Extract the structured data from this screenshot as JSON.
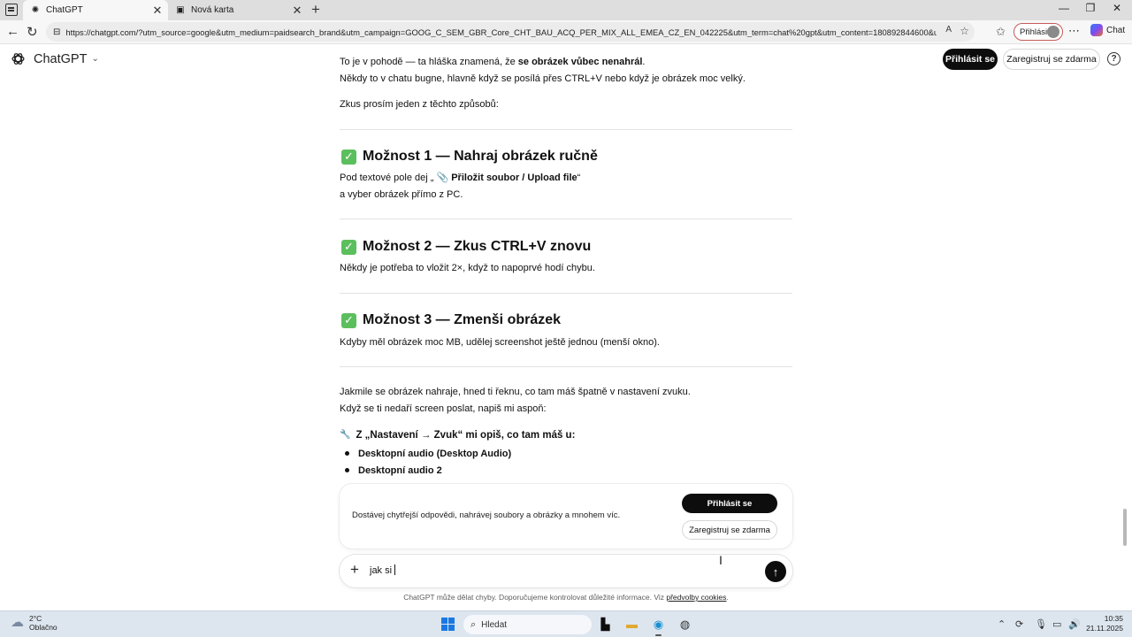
{
  "browser": {
    "tabs": [
      {
        "title": "ChatGPT",
        "active": true
      },
      {
        "title": "Nová karta",
        "active": false
      }
    ],
    "url": "https://chatgpt.com/?utm_source=google&utm_medium=paidsearch_brand&utm_campaign=GOOG_C_SEM_GBR_Core_CHT_BAU_ACQ_PER_MIX_ALL_EMEA_CZ_EN_042225&utm_term=chat%20gpt&utm_content=180892844600&utm_ad=7...",
    "profile_label": "Přihlásit",
    "copilot_label": "Chat"
  },
  "header": {
    "brand": "ChatGPT",
    "login_label": "Přihlásit se",
    "register_label": "Zaregistruj se zdarma"
  },
  "message": {
    "intro_1_prefix": "To je v pohodě — ta hláška znamená, že ",
    "intro_1_bold": "se obrázek vůbec nenahrál",
    "intro_1_suffix": ".",
    "intro_2": "Někdy to v chatu bugne, hlavně když se posílá přes CTRL+V nebo když je obrázek moc velký.",
    "intro_3": "Zkus prosím jeden z těchto způsobů:",
    "option1_title": "Možnost 1 — Nahraj obrázek ručně",
    "option1_line1_prefix": "Pod textové pole dej „ 📎 ",
    "option1_line1_bold": "Přiložit soubor / Upload file",
    "option1_line1_suffix": "“",
    "option1_line2": "a vyber obrázek přímo z PC.",
    "option2_title": "Možnost 2 — Zkus CTRL+V znovu",
    "option2_text": "Někdy je potřeba to vložit 2×, když to napoprvé hodí chybu.",
    "option3_title": "Možnost 3 — Zmenši obrázek",
    "option3_text": "Kdyby měl obrázek moc MB, udělej screenshot ještě jednou (menší okno).",
    "outro_1": "Jakmile se obrázek nahraje, hned ti řeknu, co tam máš špatně v nastavení zvuku.",
    "outro_2": "Když se ti nedaří screen poslat, napiš mi aspoň:",
    "sub_heading": "Z „Nastavení → Zvuk“ mi opiš, co tam máš u:",
    "bullets": [
      "Desktopní audio (Desktop Audio)",
      "Desktopní audio 2"
    ]
  },
  "promo": {
    "text": "Dostávej chytřejší odpovědi, nahrávej soubory a obrázky a mnohem víc.",
    "login_label": "Přihlásit se",
    "register_label": "Zaregistruj se zdarma"
  },
  "composer": {
    "value": "jak si",
    "disclaimer_prefix": "ChatGPT může dělat chyby. Doporučujeme kontrolovat důležité informace. Viz ",
    "disclaimer_link": "předvolby cookies",
    "disclaimer_suffix": "."
  },
  "taskbar": {
    "temp": "2°C",
    "weather": "Oblačno",
    "search_placeholder": "Hledat",
    "time": "10:35",
    "date": "21.11.2025"
  },
  "icons": {
    "brand_color": "#0d0d0d",
    "check_color": "#5cbf5e",
    "start_color": "#1b78e2"
  }
}
